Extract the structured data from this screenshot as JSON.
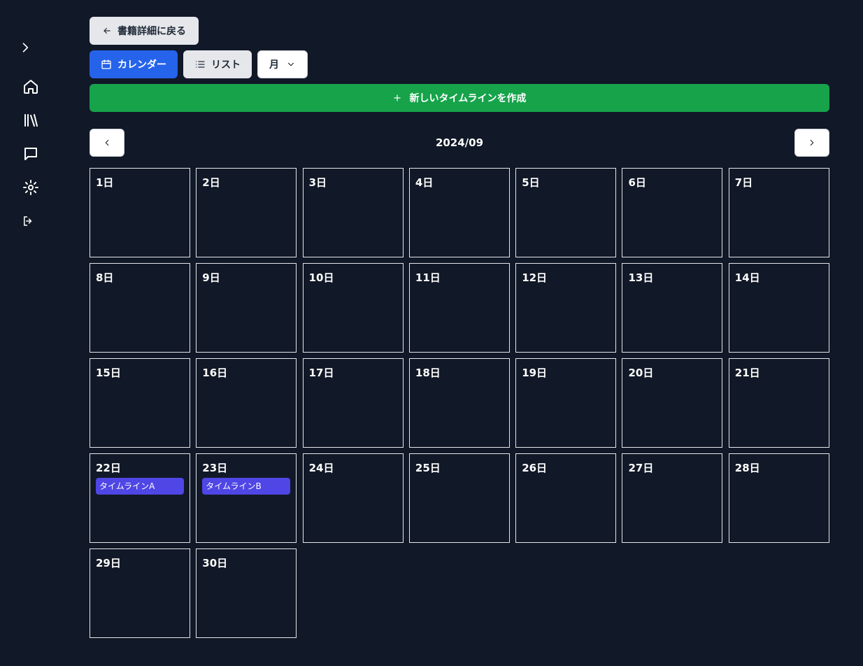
{
  "sidebar": {
    "icons": [
      "chevron-right-icon",
      "home-icon",
      "library-icon",
      "message-icon",
      "gear-icon",
      "logout-icon"
    ]
  },
  "header": {
    "back_label": "書籍詳細に戻る",
    "calendar_label": "カレンダー",
    "list_label": "リスト",
    "view_select_value": "月",
    "create_label": "新しいタイムラインを作成"
  },
  "calendar": {
    "month_title": "2024/09",
    "days": [
      {
        "label": "1日",
        "events": []
      },
      {
        "label": "2日",
        "events": []
      },
      {
        "label": "3日",
        "events": []
      },
      {
        "label": "4日",
        "events": []
      },
      {
        "label": "5日",
        "events": []
      },
      {
        "label": "6日",
        "events": []
      },
      {
        "label": "7日",
        "events": []
      },
      {
        "label": "8日",
        "events": []
      },
      {
        "label": "9日",
        "events": []
      },
      {
        "label": "10日",
        "events": []
      },
      {
        "label": "11日",
        "events": []
      },
      {
        "label": "12日",
        "events": []
      },
      {
        "label": "13日",
        "events": []
      },
      {
        "label": "14日",
        "events": []
      },
      {
        "label": "15日",
        "events": []
      },
      {
        "label": "16日",
        "events": []
      },
      {
        "label": "17日",
        "events": []
      },
      {
        "label": "18日",
        "events": []
      },
      {
        "label": "19日",
        "events": []
      },
      {
        "label": "20日",
        "events": []
      },
      {
        "label": "21日",
        "events": []
      },
      {
        "label": "22日",
        "events": [
          "タイムラインA"
        ]
      },
      {
        "label": "23日",
        "events": [
          "タイムラインB"
        ]
      },
      {
        "label": "24日",
        "events": []
      },
      {
        "label": "25日",
        "events": []
      },
      {
        "label": "26日",
        "events": []
      },
      {
        "label": "27日",
        "events": []
      },
      {
        "label": "28日",
        "events": []
      },
      {
        "label": "29日",
        "events": []
      },
      {
        "label": "30日",
        "events": []
      }
    ]
  },
  "colors": {
    "background": "#111827",
    "primary": "#2563eb",
    "create": "#16a34a",
    "event": "#4f46e5"
  }
}
